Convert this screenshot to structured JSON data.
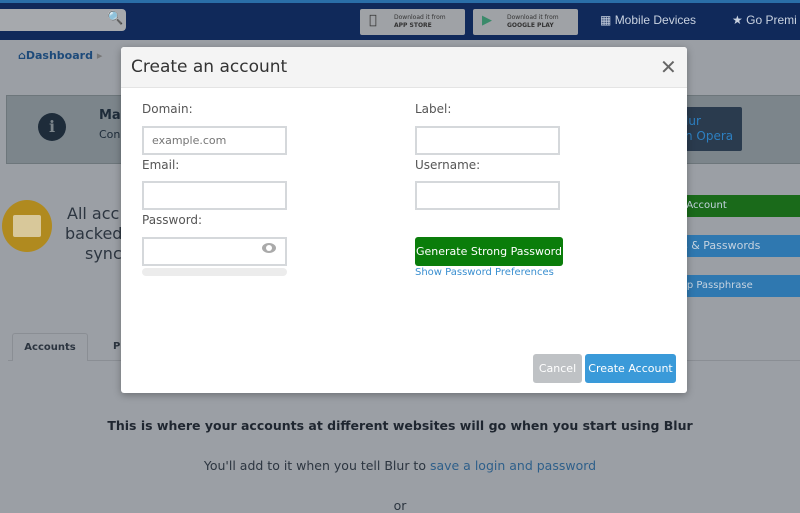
{
  "header": {
    "app_store": {
      "line1": "Download it from",
      "line2": "APP STORE"
    },
    "google_play": {
      "line1": "Download it from",
      "line2": "GOOGLE PLAY"
    },
    "mobile_devices": "Mobile Devices",
    "go_premium": "Go Premi"
  },
  "breadcrumb": {
    "home": "Dashboard"
  },
  "banner": {
    "title": "Ma",
    "subtitle": "Con",
    "button_line1": "lur",
    "button_line2": "n Opera"
  },
  "summary": {
    "line1": "All acc",
    "line2": "backed",
    "line3": "sync"
  },
  "side_buttons": {
    "new_account": "w Account",
    "logins": "ns & Passwords",
    "passphrase": "kup Passphrase"
  },
  "tabs": [
    {
      "label": "Accounts"
    },
    {
      "label": "P"
    }
  ],
  "empty_state": {
    "title": "This is where your accounts at different websites will go when you start using Blur",
    "sub_prefix": "You'll add to it when you tell Blur to ",
    "sub_link": "save a login and password",
    "or": "or"
  },
  "modal": {
    "title": "Create an account",
    "domain_label": "Domain:",
    "domain_placeholder": "example.com",
    "domain_value": "",
    "email_label": "Email:",
    "email_value": "",
    "password_label": "Password:",
    "password_value": "",
    "label_label": "Label:",
    "label_value": "",
    "username_label": "Username:",
    "username_value": "",
    "generate_button": "Generate Strong Password",
    "prefs_link": "Show Password Preferences",
    "cancel_button": "Cancel",
    "create_button": "Create Account",
    "password_strength": 0
  },
  "colors": {
    "header": "#10295a",
    "generate": "#0a7d0a",
    "primary": "#3a9ad9",
    "link": "#3a8fd0"
  }
}
